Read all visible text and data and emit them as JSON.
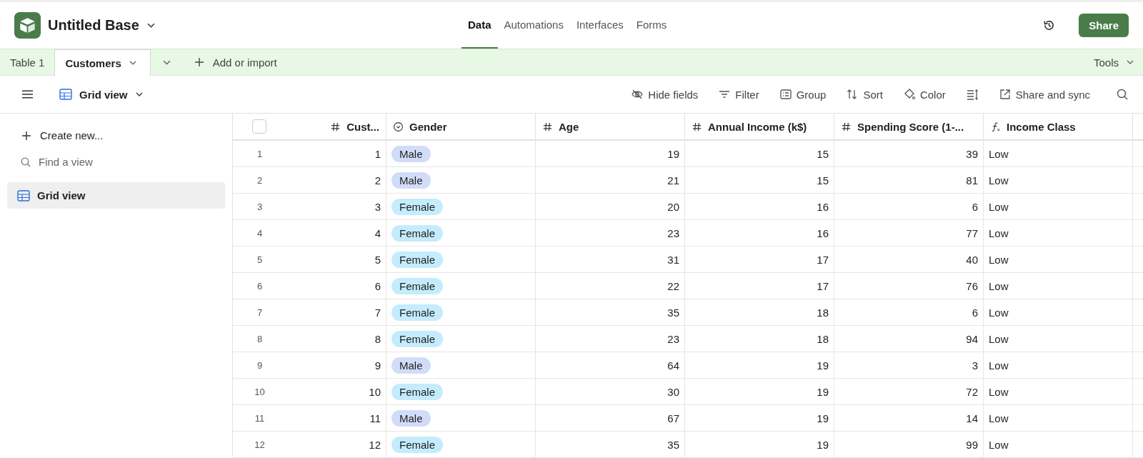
{
  "app": {
    "title": "Untitled Base"
  },
  "nav_tabs": [
    {
      "label": "Data",
      "selected": true
    },
    {
      "label": "Automations",
      "selected": false
    },
    {
      "label": "Interfaces",
      "selected": false
    },
    {
      "label": "Forms",
      "selected": false
    }
  ],
  "share_button": "Share",
  "table_tabs": [
    {
      "label": "Table 1",
      "selected": false
    },
    {
      "label": "Customers",
      "selected": true
    }
  ],
  "add_or_import": "Add or import",
  "tools": "Tools",
  "view": {
    "label": "Grid view"
  },
  "toolbar": [
    {
      "kind": "hide",
      "label": "Hide fields"
    },
    {
      "kind": "filter",
      "label": "Filter"
    },
    {
      "kind": "group",
      "label": "Group"
    },
    {
      "kind": "sort",
      "label": "Sort"
    },
    {
      "kind": "color",
      "label": "Color"
    },
    {
      "kind": "rowheight"
    },
    {
      "kind": "share",
      "label": "Share and sync"
    }
  ],
  "sidebar": {
    "create_new": "Create new...",
    "find_placeholder": "Find a view",
    "views": [
      {
        "label": "Grid view",
        "selected": true
      }
    ]
  },
  "select_all": {
    "checked": false
  },
  "columns": [
    {
      "kind": "number",
      "label": "Cust..."
    },
    {
      "kind": "select",
      "label": "Gender"
    },
    {
      "kind": "number",
      "label": "Age"
    },
    {
      "kind": "number",
      "label": "Annual Income (k$)"
    },
    {
      "kind": "number",
      "label": "Spending Score (1-..."
    },
    {
      "kind": "formula",
      "label": "Income Class"
    }
  ],
  "rows": [
    {
      "number": "1",
      "cells": [
        "1",
        "Male",
        "19",
        "15",
        "39",
        "Low"
      ],
      "color": "#d1dcf9"
    },
    {
      "number": "2",
      "cells": [
        "2",
        "Male",
        "21",
        "15",
        "81",
        "Low"
      ],
      "color": "#d1dcf9"
    },
    {
      "number": "3",
      "cells": [
        "3",
        "Female",
        "20",
        "16",
        "6",
        "Low"
      ],
      "color": "#c4ecfd"
    },
    {
      "number": "4",
      "cells": [
        "4",
        "Female",
        "23",
        "16",
        "77",
        "Low"
      ],
      "color": "#c4ecfd"
    },
    {
      "number": "5",
      "cells": [
        "5",
        "Female",
        "31",
        "17",
        "40",
        "Low"
      ],
      "color": "#c4ecfd"
    },
    {
      "number": "6",
      "cells": [
        "6",
        "Female",
        "22",
        "17",
        "76",
        "Low"
      ],
      "color": "#c4ecfd"
    },
    {
      "number": "7",
      "cells": [
        "7",
        "Female",
        "35",
        "18",
        "6",
        "Low"
      ],
      "color": "#c4ecfd"
    },
    {
      "number": "8",
      "cells": [
        "8",
        "Female",
        "23",
        "18",
        "94",
        "Low"
      ],
      "color": "#c4ecfd"
    },
    {
      "number": "9",
      "cells": [
        "9",
        "Male",
        "64",
        "19",
        "3",
        "Low"
      ],
      "color": "#d1dcf9"
    },
    {
      "number": "10",
      "cells": [
        "10",
        "Female",
        "30",
        "19",
        "72",
        "Low"
      ],
      "color": "#c4ecfd"
    },
    {
      "number": "11",
      "cells": [
        "11",
        "Male",
        "67",
        "19",
        "14",
        "Low"
      ],
      "color": "#d1dcf9"
    },
    {
      "number": "12",
      "cells": [
        "12",
        "Female",
        "35",
        "19",
        "99",
        "Low"
      ],
      "color": "#c4ecfd"
    }
  ]
}
